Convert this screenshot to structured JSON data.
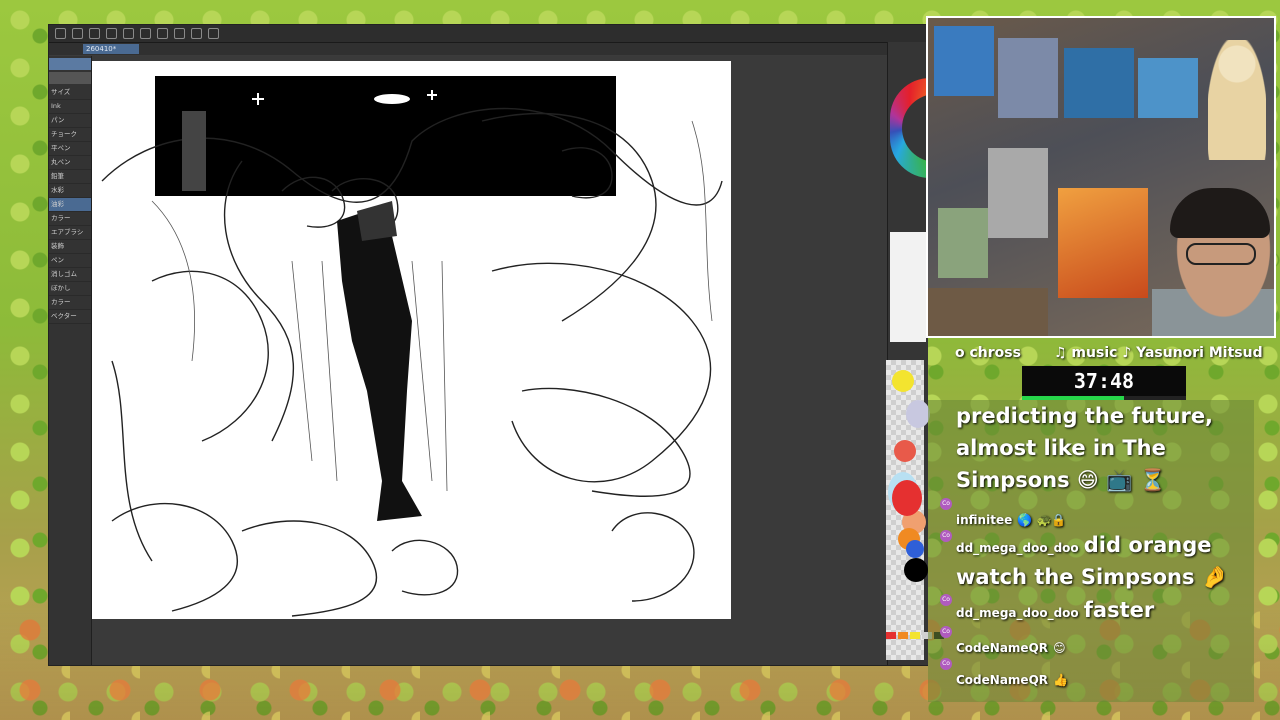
{
  "app": {
    "tab_label": "260410*",
    "left_panel": [
      "サイズ",
      "Ink",
      "パン",
      "チョーク",
      "平ペン",
      "丸ペン",
      "鉛筆",
      "水彩",
      "油彩",
      "カラー",
      "エアブラシ",
      "装飾",
      "ペン",
      "消しゴム",
      "ぼかし",
      "カラー",
      "ベクター"
    ]
  },
  "palette": {
    "colors": [
      "#f3e42f",
      "#c8c8e0",
      "#e85a4a",
      "#b8e0f2",
      "#f0a070",
      "#e53030",
      "#f08a22",
      "#2f5fd8",
      "#000000"
    ],
    "swatches": [
      "#e53030",
      "#f08a22",
      "#f3e42f",
      "#d0d0d0",
      "#0a0a0a"
    ]
  },
  "stream": {
    "chat_name": "o chross",
    "music": "♫ music ♪ Yasunori Mitsud",
    "timer": "37:48",
    "timer_progress": 0.62
  },
  "chat": {
    "lines": [
      "predicting the future,",
      "almost like in The",
      "Simpsons 😄 📺 ⏳"
    ],
    "messages": [
      {
        "user": "infinitee",
        "text": "🌎 🐢🔒"
      },
      {
        "user": "dd_mega_doo_doo",
        "text": "did orange"
      },
      {
        "user": "",
        "text": "watch the Simpsons 🤌"
      },
      {
        "user": "dd_mega_doo_doo",
        "text": "faster"
      },
      {
        "user": "CodeNameQR",
        "text": "😊"
      },
      {
        "user": "CodeNameQR",
        "text": "👍"
      }
    ]
  }
}
